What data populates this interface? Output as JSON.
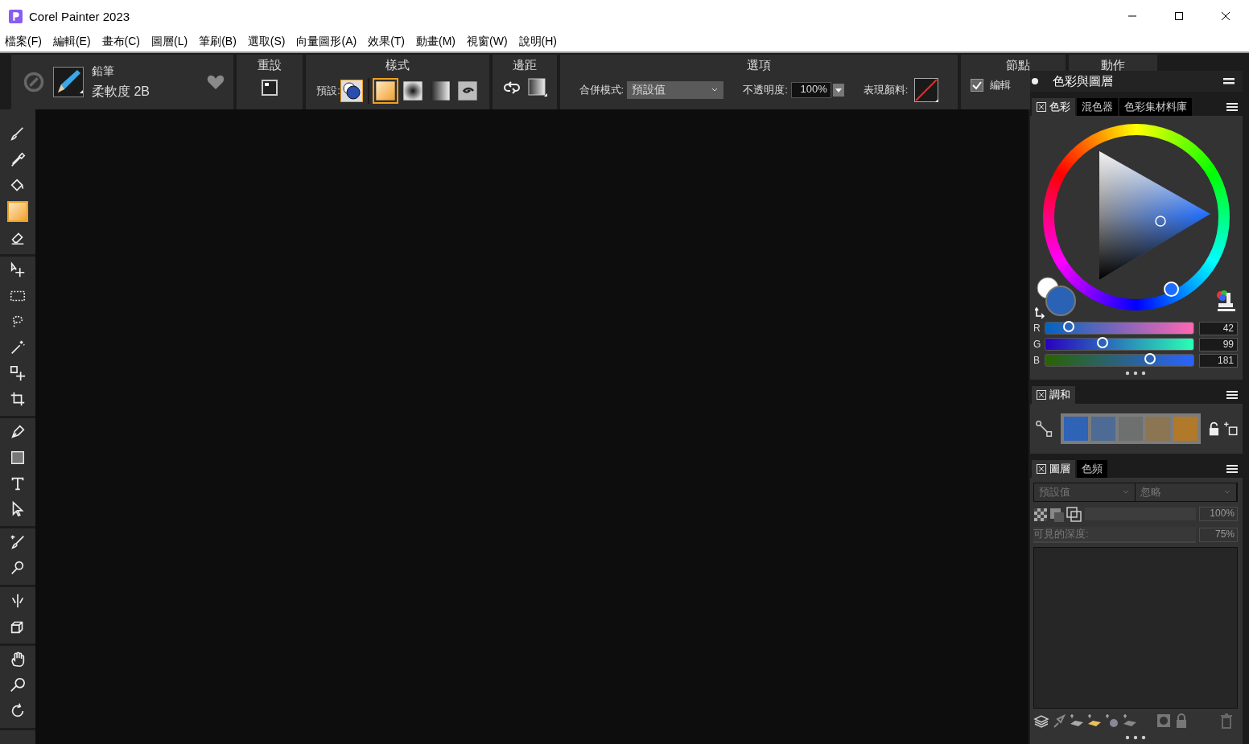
{
  "window": {
    "title": "Corel Painter 2023"
  },
  "menu": [
    "檔案(F)",
    "編輯(E)",
    "畫布(C)",
    "圖層(L)",
    "筆刷(B)",
    "選取(S)",
    "向量圖形(A)",
    "效果(T)",
    "動畫(M)",
    "視窗(W)",
    "說明(H)"
  ],
  "brush": {
    "category": "鉛筆",
    "variant": "柔軟度 2B"
  },
  "reset": {
    "title": "重設"
  },
  "style": {
    "title": "樣式",
    "preset_label": "預設:",
    "styles": [
      {
        "kind": "flat",
        "selected": true
      },
      {
        "kind": "radial",
        "selected": false
      },
      {
        "kind": "linear",
        "selected": false
      },
      {
        "kind": "spiral",
        "selected": false
      }
    ]
  },
  "boundary": {
    "title": "邊距"
  },
  "options": {
    "title": "選項",
    "blend_label": "合併模式:",
    "blend_value": "預設值",
    "opacity_label": "不透明度:",
    "opacity_value": "100%",
    "paint_label": "表現顏料:"
  },
  "nodes": {
    "title": "節點",
    "edit_label": "編輯",
    "edit_checked": true
  },
  "actions": {
    "title": "動作"
  },
  "toolbox": [
    [
      {
        "kind": "brush",
        "selected": false
      },
      {
        "kind": "dropper",
        "selected": false
      },
      {
        "kind": "bucket",
        "selected": false
      },
      {
        "kind": "fill",
        "selected": true
      },
      {
        "kind": "eraser",
        "selected": false
      }
    ],
    [
      {
        "kind": "transform",
        "selected": false
      },
      {
        "kind": "rect-select",
        "selected": false
      },
      {
        "kind": "lasso",
        "selected": false
      },
      {
        "kind": "wand",
        "selected": false
      },
      {
        "kind": "adjuster",
        "selected": false
      },
      {
        "kind": "crop",
        "selected": false
      }
    ],
    [
      {
        "kind": "pen",
        "selected": false
      },
      {
        "kind": "shape",
        "selected": false
      },
      {
        "kind": "text",
        "selected": false
      },
      {
        "kind": "pointer",
        "selected": false
      }
    ],
    [
      {
        "kind": "cloner",
        "selected": false
      },
      {
        "kind": "sampler",
        "selected": false
      }
    ],
    [
      {
        "kind": "mirror",
        "selected": false
      },
      {
        "kind": "perspective",
        "selected": false
      }
    ],
    [
      {
        "kind": "hand",
        "selected": false
      },
      {
        "kind": "zoom",
        "selected": false
      },
      {
        "kind": "rotate",
        "selected": false
      }
    ]
  ],
  "panel": {
    "title": "色彩與圖層",
    "color_tabs": [
      {
        "label": "色彩",
        "selected": true
      },
      {
        "label": "混色器",
        "selected": false
      },
      {
        "label": "色彩集材料庫",
        "selected": false
      }
    ],
    "rgb": [
      {
        "name": "R",
        "value": "42",
        "level": 0.165
      },
      {
        "name": "G",
        "value": "99",
        "level": 0.39
      },
      {
        "name": "B",
        "value": "181",
        "level": 0.71
      }
    ],
    "harmony_tab": "調和",
    "swatches": [
      {
        "color": "#2e63b5"
      },
      {
        "color": "#4d6b94"
      },
      {
        "color": "#6e7070"
      },
      {
        "color": "#8b7552"
      },
      {
        "color": "#b07a2a"
      }
    ],
    "layer_tabs": [
      {
        "label": "圖層",
        "selected": true
      },
      {
        "label": "色頻",
        "selected": false
      }
    ],
    "layers": {
      "composite": "預設值",
      "method": "忽略",
      "opacity": "100%",
      "depth_label": "可見的深度:",
      "depth": "75%"
    }
  }
}
